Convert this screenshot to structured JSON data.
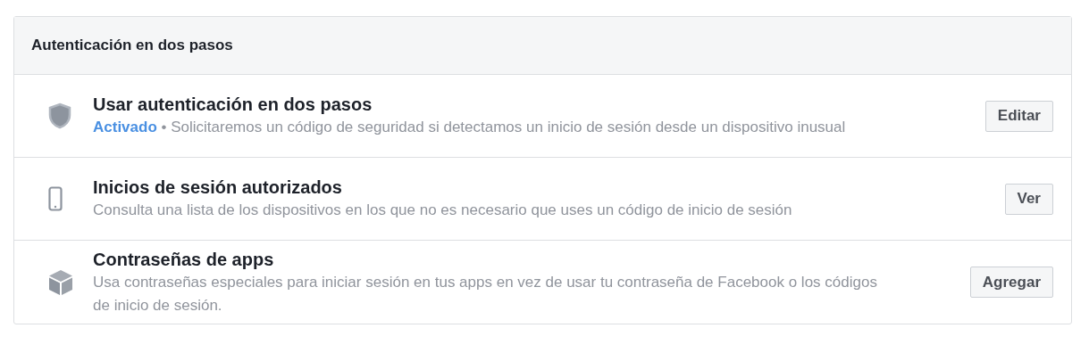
{
  "panel": {
    "title": "Autenticación en dos pasos"
  },
  "rows": [
    {
      "title": "Usar autenticación en dos pasos",
      "status": "Activado",
      "description": "• Solicitaremos un código de seguridad si detectamos un inicio de sesión desde un dispositivo inusual",
      "button": "Editar"
    },
    {
      "title": "Inicios de sesión autorizados",
      "description": "Consulta una lista de los dispositivos en los que no es necesario que uses un código de inicio de sesión",
      "button": "Ver"
    },
    {
      "title": "Contraseñas de apps",
      "description": "Usa contraseñas especiales para iniciar sesión en tus apps en vez de usar tu contraseña de Facebook o los códigos de inicio de sesión.",
      "button": "Agregar"
    }
  ]
}
